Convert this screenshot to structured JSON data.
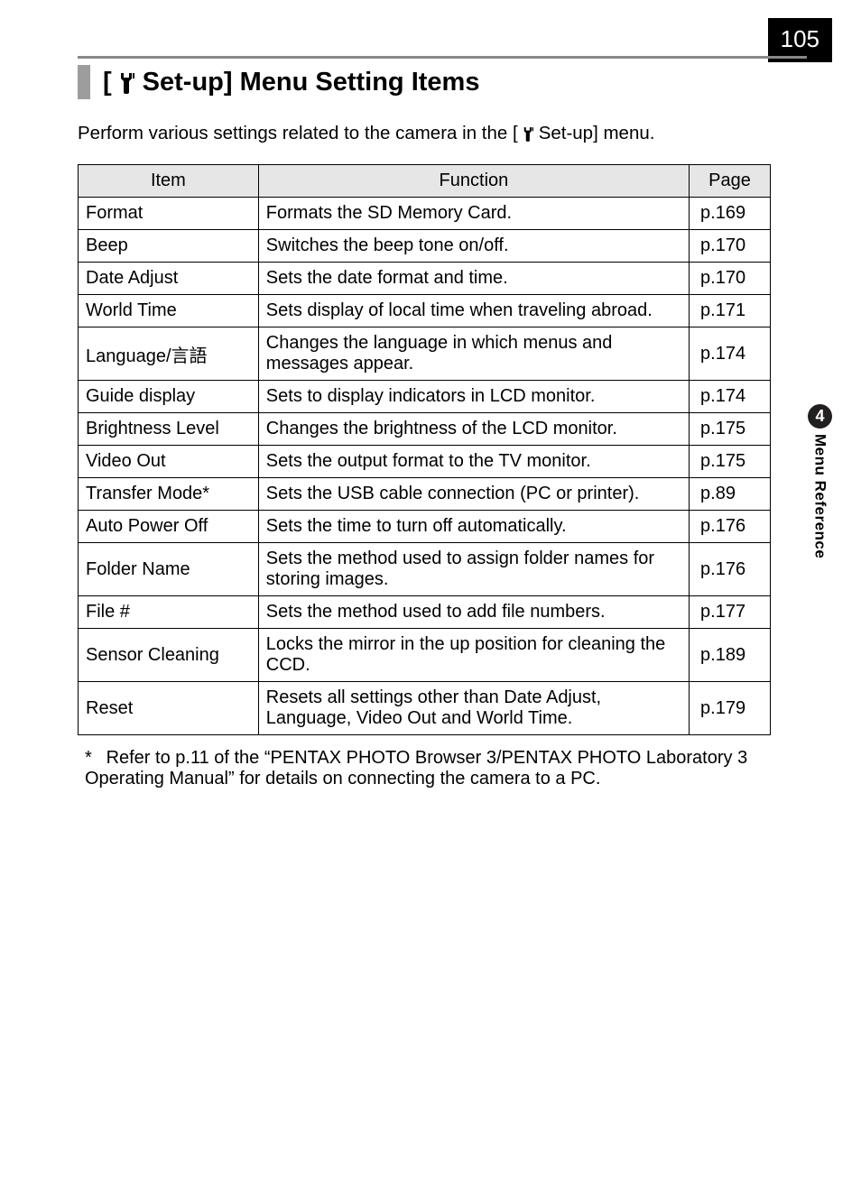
{
  "page_number": "105",
  "heading": {
    "prefix": "[",
    "icon": "wrench-icon",
    "label": " Set-up] Menu Setting Items"
  },
  "intro": {
    "before": "Perform various settings related to the camera in the [",
    "after": " Set-up] menu."
  },
  "table": {
    "headers": {
      "item": "Item",
      "function": "Function",
      "page": "Page"
    },
    "rows": [
      {
        "item": "Format",
        "function": "Formats the SD Memory Card.",
        "page": "p.169"
      },
      {
        "item": "Beep",
        "function": "Switches the beep tone on/off.",
        "page": "p.170"
      },
      {
        "item": "Date Adjust",
        "function": "Sets the date format and time.",
        "page": "p.170"
      },
      {
        "item": "World Time",
        "function": "Sets display of local time when traveling abroad.",
        "page": "p.171"
      },
      {
        "item": "Language/言語",
        "function": "Changes the language in which menus and messages appear.",
        "page": "p.174"
      },
      {
        "item": "Guide display",
        "function": "Sets to display indicators in LCD monitor.",
        "page": "p.174"
      },
      {
        "item": "Brightness Level",
        "function": "Changes the brightness of the LCD monitor.",
        "page": "p.175"
      },
      {
        "item": "Video Out",
        "function": "Sets the output format to the TV monitor.",
        "page": "p.175"
      },
      {
        "item": "Transfer Mode*",
        "function": "Sets the USB cable connection (PC or printer).",
        "page": "p.89"
      },
      {
        "item": "Auto Power Off",
        "function": "Sets the time to turn off automatically.",
        "page": "p.176"
      },
      {
        "item": "Folder Name",
        "function": "Sets the method used to assign folder names for storing images.",
        "page": "p.176"
      },
      {
        "item": "File #",
        "function": "Sets the method used to add file numbers.",
        "page": "p.177"
      },
      {
        "item": "Sensor Cleaning",
        "function": "Locks the mirror in the up position for cleaning the CCD.",
        "page": "p.189"
      },
      {
        "item": "Reset",
        "function": "Resets all settings other than Date Adjust, Language, Video Out and World Time.",
        "page": "p.179"
      }
    ]
  },
  "footnote": "Refer to p.11 of the “PENTAX PHOTO Browser 3/PENTAX PHOTO Laboratory 3 Operating Manual” for details on connecting the camera to a PC.",
  "side_tab": {
    "chapter": "4",
    "label": "Menu Reference"
  }
}
